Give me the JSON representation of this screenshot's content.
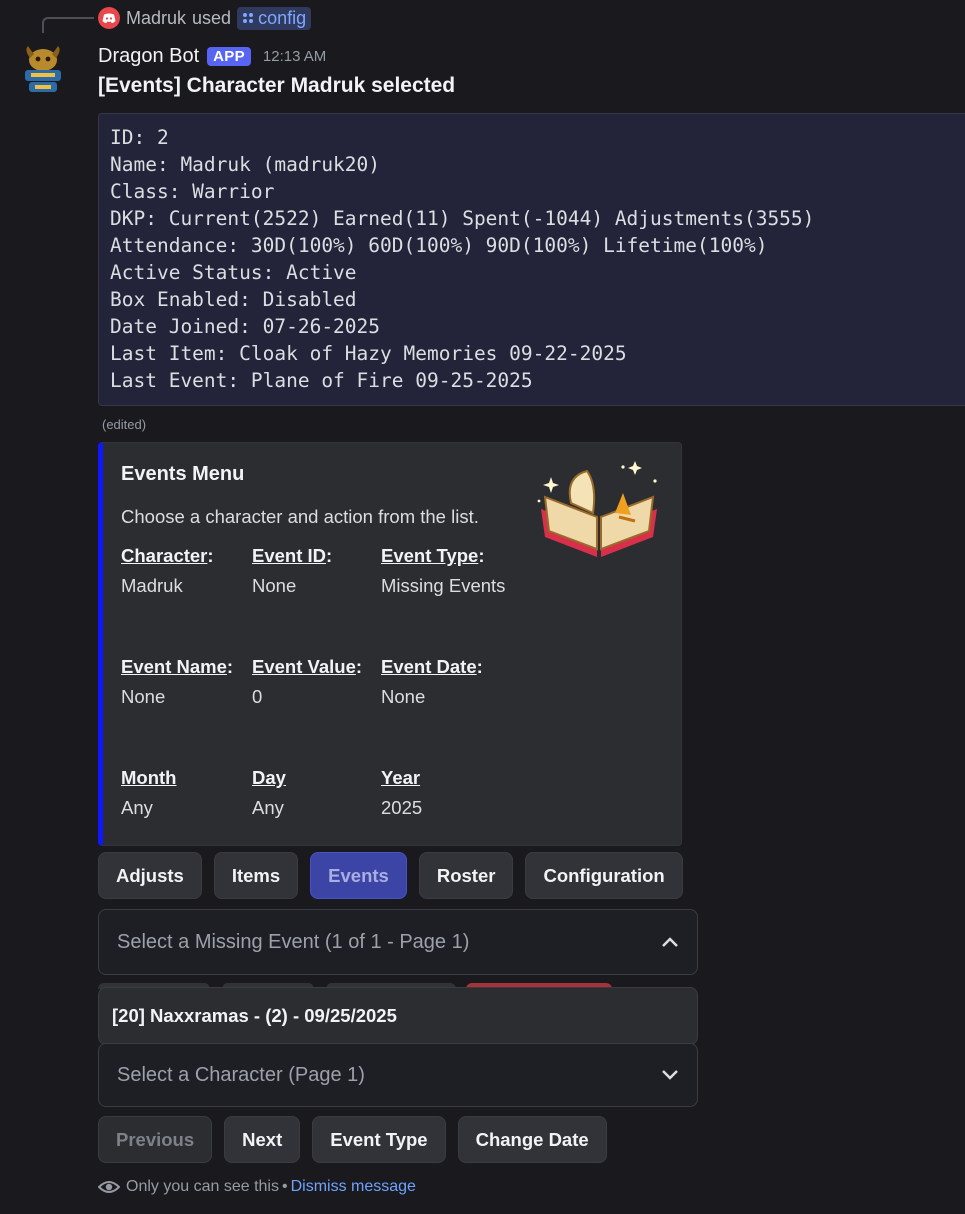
{
  "reply": {
    "user": "Madruk",
    "action": "used",
    "command": "config"
  },
  "message": {
    "author": "Dragon Bot",
    "badge": "APP",
    "time": "12:13 AM",
    "title": "[Events] Character Madruk selected",
    "code_lines": [
      "ID: 2",
      "Name: Madruk (madruk20)",
      "Class: Warrior",
      "DKP: Current(2522) Earned(11) Spent(-1044) Adjustments(3555)",
      "Attendance: 30D(100%) 60D(100%) 90D(100%) Lifetime(100%)",
      "Active Status: Active",
      "Box Enabled: Disabled",
      "Date Joined: 07-26-2025",
      "Last Item: Cloak of Hazy Memories 09-22-2025",
      "Last Event: Plane of Fire 09-25-2025"
    ],
    "edited": "(edited)"
  },
  "embed": {
    "accent": "#0f17ff",
    "title": "Events Menu",
    "description": "Choose a character and action from the list.",
    "fields": [
      {
        "name": "Character",
        "suffix": ":",
        "value": "Madruk"
      },
      {
        "name": "Event ID",
        "suffix": ":",
        "value": "None"
      },
      {
        "name": "Event Type",
        "suffix": ":",
        "value": "Missing Events"
      },
      {
        "name": "Event Name",
        "suffix": ":",
        "value": "None"
      },
      {
        "name": "Event Value",
        "suffix": ":",
        "value": "0"
      },
      {
        "name": "Event Date",
        "suffix": ":",
        "value": "None"
      },
      {
        "name": "Month",
        "suffix": "",
        "value": "Any"
      },
      {
        "name": "Day",
        "suffix": "",
        "value": "Any"
      },
      {
        "name": "Year",
        "suffix": "",
        "value": "2025"
      }
    ]
  },
  "nav_buttons": [
    "Adjusts",
    "Items",
    "Events",
    "Roster",
    "Configuration"
  ],
  "event_select": {
    "placeholder": "Select a Missing Event (1 of 1 - Page 1)",
    "option": "[20] Naxxramas - (2) - 09/25/2025"
  },
  "character_select": {
    "placeholder": "Select a Character (Page 1)"
  },
  "action_buttons": [
    "Previous",
    "Next",
    "Event Type",
    "Change Date"
  ],
  "footer": {
    "text": "Only you can see this",
    "separator": "•",
    "dismiss": "Dismiss message"
  },
  "colors": {
    "background": "#1a1a1e",
    "blurple": "#5865f2",
    "link": "#6ea2ff"
  }
}
